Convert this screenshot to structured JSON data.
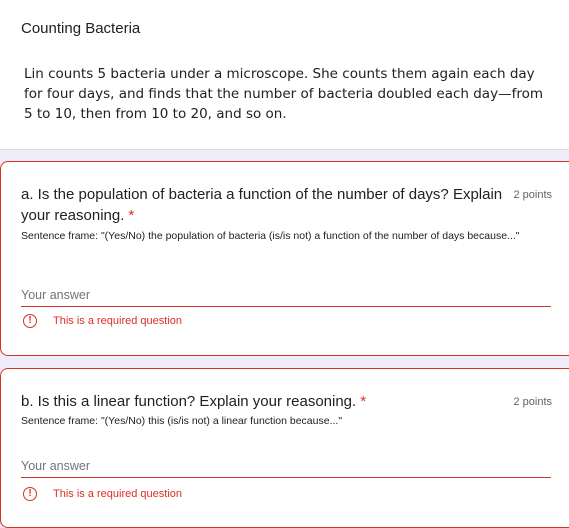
{
  "section": {
    "title": "Counting Bacteria",
    "description": "Lin counts 5 bacteria under a microscope. She counts them again each day for four days, and finds that the number of bacteria doubled each day—from 5 to 10, then from 10 to 20, and so on."
  },
  "questions": [
    {
      "title": "a. Is the population of bacteria a function of the number of days? Explain your reasoning.",
      "required_marker": "*",
      "points": "2 points",
      "description": "Sentence frame: \"(Yes/No) the population of bacteria (is/is not) a function of the number of days because...\"",
      "answer_placeholder": "Your answer",
      "answer_value": "",
      "error": "This is a required question",
      "error_icon": "!"
    },
    {
      "title": "b. Is this a linear function? Explain your reasoning.",
      "required_marker": "*",
      "points": "2 points",
      "description": "Sentence frame: \"(Yes/No) this (is/is not) a linear function because...\"",
      "answer_placeholder": "Your answer",
      "answer_value": "",
      "error": "This is a required question",
      "error_icon": "!"
    }
  ],
  "colors": {
    "error": "#d93025",
    "background": "#f0ebf8",
    "card": "#ffffff",
    "muted": "#5f6368"
  }
}
